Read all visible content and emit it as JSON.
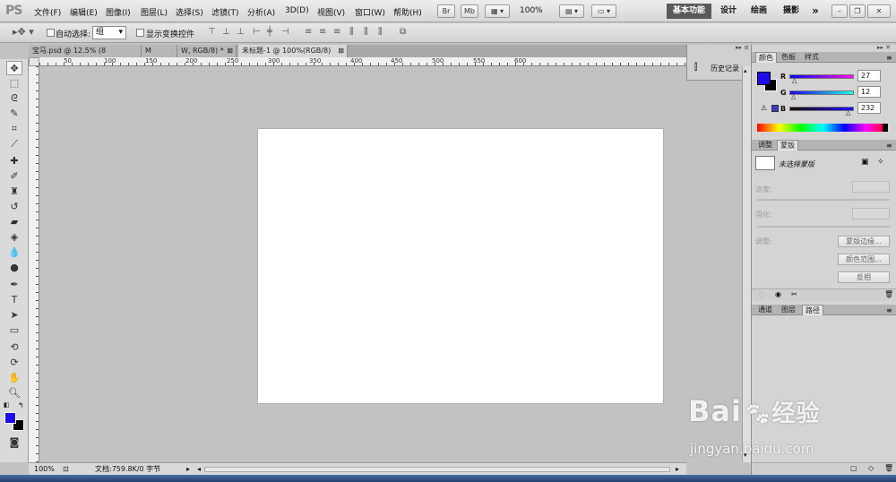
{
  "app_logo": "PS",
  "menu": [
    "文件(F)",
    "编辑(E)",
    "图像(I)",
    "图层(L)",
    "选择(S)",
    "滤镜(T)",
    "分析(A)",
    "3D(D)",
    "视图(V)",
    "窗口(W)",
    "帮助(H)"
  ],
  "menu_buttons": {
    "br": "Br",
    "mb": "Mb",
    "zoom": "100%"
  },
  "workspaces": [
    "基本功能",
    "设计",
    "绘画",
    "摄影"
  ],
  "more": "»",
  "options": {
    "auto_select": "自动选择:",
    "group": "组",
    "show_transform": "显示变换控件"
  },
  "tabs": [
    {
      "label": "宝马.psd @ 12.5% (8"
    },
    {
      "label": "M"
    },
    {
      "label": "W, RGB/8) *"
    },
    {
      "label": "未标题-1 @ 100%(RGB/8)"
    }
  ],
  "ruler_h": [
    "50",
    "100",
    "150",
    "200",
    "250",
    "300",
    "350",
    "400",
    "450",
    "500",
    "550",
    "600"
  ],
  "history_panel": "历史记录",
  "color_panel": {
    "tabs": [
      "颜色",
      "色板",
      "样式"
    ],
    "channels": [
      {
        "label": "R",
        "value": "27"
      },
      {
        "label": "G",
        "value": "12"
      },
      {
        "label": "B",
        "value": "232"
      }
    ],
    "fg_color": "#1b0ce8",
    "bg_color": "#000000"
  },
  "adjust_panel": {
    "tabs": [
      "调整",
      "蒙版"
    ],
    "mask_label": "未选择蒙版",
    "density": "浓度:",
    "feather": "羽化:",
    "refine": "调整:",
    "buttons": [
      "蒙版边缘...",
      "颜色范围...",
      "反相"
    ]
  },
  "layers_panel": {
    "tabs": [
      "通道",
      "图层",
      "路径"
    ]
  },
  "status": {
    "zoom": "100%",
    "doc": "文档:759.8K/0 字节"
  },
  "watermark": {
    "brand": "Bai",
    "brand2": "经验",
    "url": "jingyan.baidu.com"
  }
}
